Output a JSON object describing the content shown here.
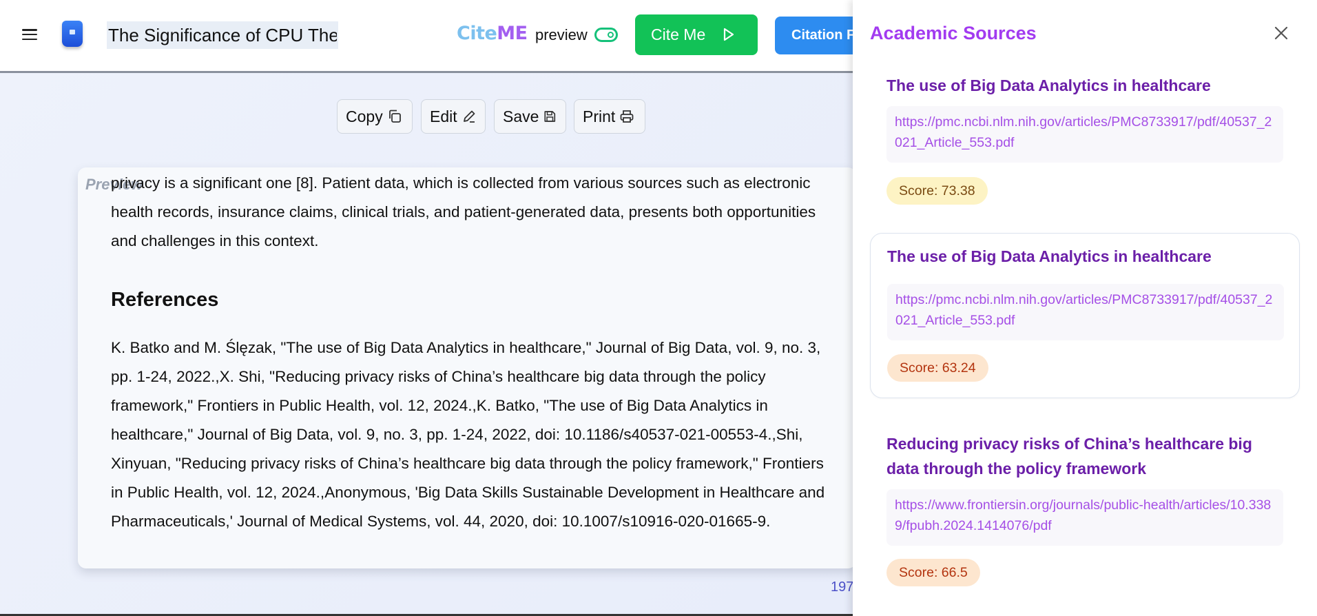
{
  "header": {
    "document_title": "The Significance of CPU The",
    "brand_part1": "Cite",
    "brand_part2": "ME",
    "preview_label": "preview",
    "cite_button_label": "Cite Me",
    "citation_button_label": "Citation F"
  },
  "toolbar": {
    "copy_label": "Copy",
    "edit_label": "Edit",
    "save_label": "Save",
    "print_label": "Print"
  },
  "document": {
    "watermark": "Preview",
    "body_lines": [
      "privacy is a significant one [8]. Patient data, which is collected from various sources such as electronic",
      "health records, insurance claims, clinical trials, and patient-generated data, presents both opportunities",
      "and challenges in this context."
    ],
    "references_heading": "References",
    "reference_lines": [
      "K. Batko and M. Ślęzak, \"The use of Big Data Analytics in healthcare,\" Journal of Big Data, vol. 9, no. 3,",
      "pp. 1-24, 2022.,X. Shi, \"Reducing privacy risks of China’s healthcare big data through the policy",
      "framework,\" Frontiers in Public Health, vol. 12, 2024.,K. Batko, \"The use of Big Data Analytics in",
      "healthcare,\" Journal of Big Data, vol. 9, no. 3, pp. 1-24, 2022, doi: 10.1186/s40537-021-00553-4.,Shi,",
      "Xinyuan, \"Reducing privacy risks of China’s healthcare big data through the policy framework,\" Frontiers",
      "in Public Health, vol. 12, 2024.,Anonymous, 'Big Data Skills Sustainable Development in Healthcare and",
      "Pharmaceuticals,' Journal of Medical Systems, vol. 44, 2020, doi: 10.1007/s10916-020-01665-9."
    ],
    "word_count": "197"
  },
  "panel": {
    "title": "Academic Sources",
    "sources": [
      {
        "title": "The use of Big Data Analytics in healthcare",
        "url": "https://pmc.ncbi.nlm.nih.gov/articles/PMC8733917/pdf/40537_2021_Article_553.pdf",
        "score": "Score: 73.38"
      },
      {
        "title": "The use of Big Data Analytics in healthcare",
        "url": "https://pmc.ncbi.nlm.nih.gov/articles/PMC8733917/pdf/40537_2021_Article_553.pdf",
        "score": "Score: 63.24"
      },
      {
        "title": "Reducing privacy risks of China’s healthcare big data through the policy framework",
        "url": "https://www.frontiersin.org/journals/public-health/articles/10.3389/fpubh.2024.1414076/pdf",
        "score": "Score: 66.5"
      }
    ]
  },
  "colors": {
    "brand_cite": "#7cc0ee",
    "brand_me": "#a35ff0",
    "cite_button": "#12c257",
    "citation_button": "#2d8cf0",
    "panel_title": "#a23bf0",
    "source_title": "#6b1fa8",
    "source_url": "#a54fe6",
    "word_count": "#4b50c8"
  },
  "icons": {
    "menu": "hamburger-icon",
    "logo": "app-logo",
    "toggle": "toggle-on-icon",
    "cite": "play-icon",
    "copy": "copy-icon",
    "edit": "pencil-icon",
    "save": "floppy-disk-icon",
    "print": "printer-icon",
    "close": "close-icon"
  }
}
